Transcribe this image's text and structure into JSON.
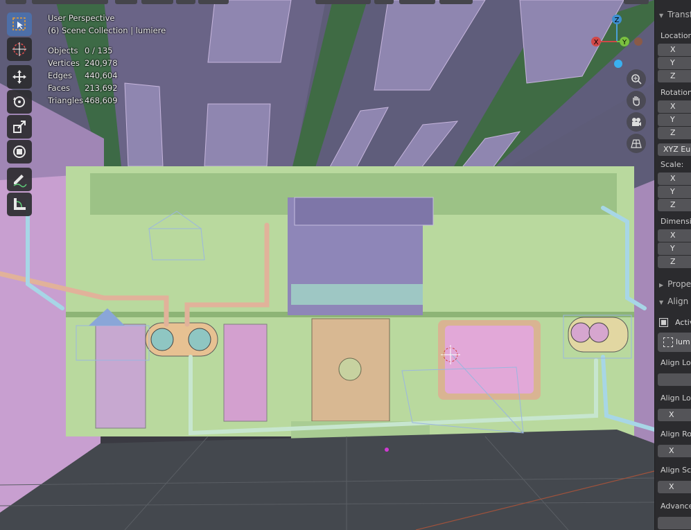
{
  "viewport": {
    "perspective": "User Perspective",
    "collection": "(6) Scene Collection | lumiere"
  },
  "stats": [
    {
      "label": "Objects",
      "value": "0 / 135"
    },
    {
      "label": "Vertices",
      "value": "240,978"
    },
    {
      "label": "Edges",
      "value": "440,604"
    },
    {
      "label": "Faces",
      "value": "213,692"
    },
    {
      "label": "Triangles",
      "value": "468,609"
    }
  ],
  "tools": [
    "select-box",
    "cursor",
    "move",
    "rotate",
    "scale",
    "transform",
    "annotate",
    "measure"
  ],
  "gizmo": {
    "z": "Z",
    "y": "Y",
    "x": "X"
  },
  "sidebar": {
    "transform_header": "Transf",
    "location_label": "Location:",
    "rotation_label": "Rotation:",
    "rotation_mode": "XYZ Eule",
    "scale_label": "Scale:",
    "dimensions_label": "Dimensio",
    "axis_x": "X",
    "axis_y": "Y",
    "axis_z": "Z",
    "properties_header": "Proper",
    "align_header": "Align",
    "active_label": "Activ",
    "object_button": "lum",
    "align_loc_1": "Align Loc",
    "align_loc_2": "Align Loc",
    "align_rot": "Align Rot",
    "align_scale": "Align Sca",
    "advanced": "Advanced"
  },
  "colors": {
    "wall": "#b6d79a",
    "ceiling": "#5b5a74",
    "floor": "#44484e",
    "accent": "#4d6fa8"
  }
}
